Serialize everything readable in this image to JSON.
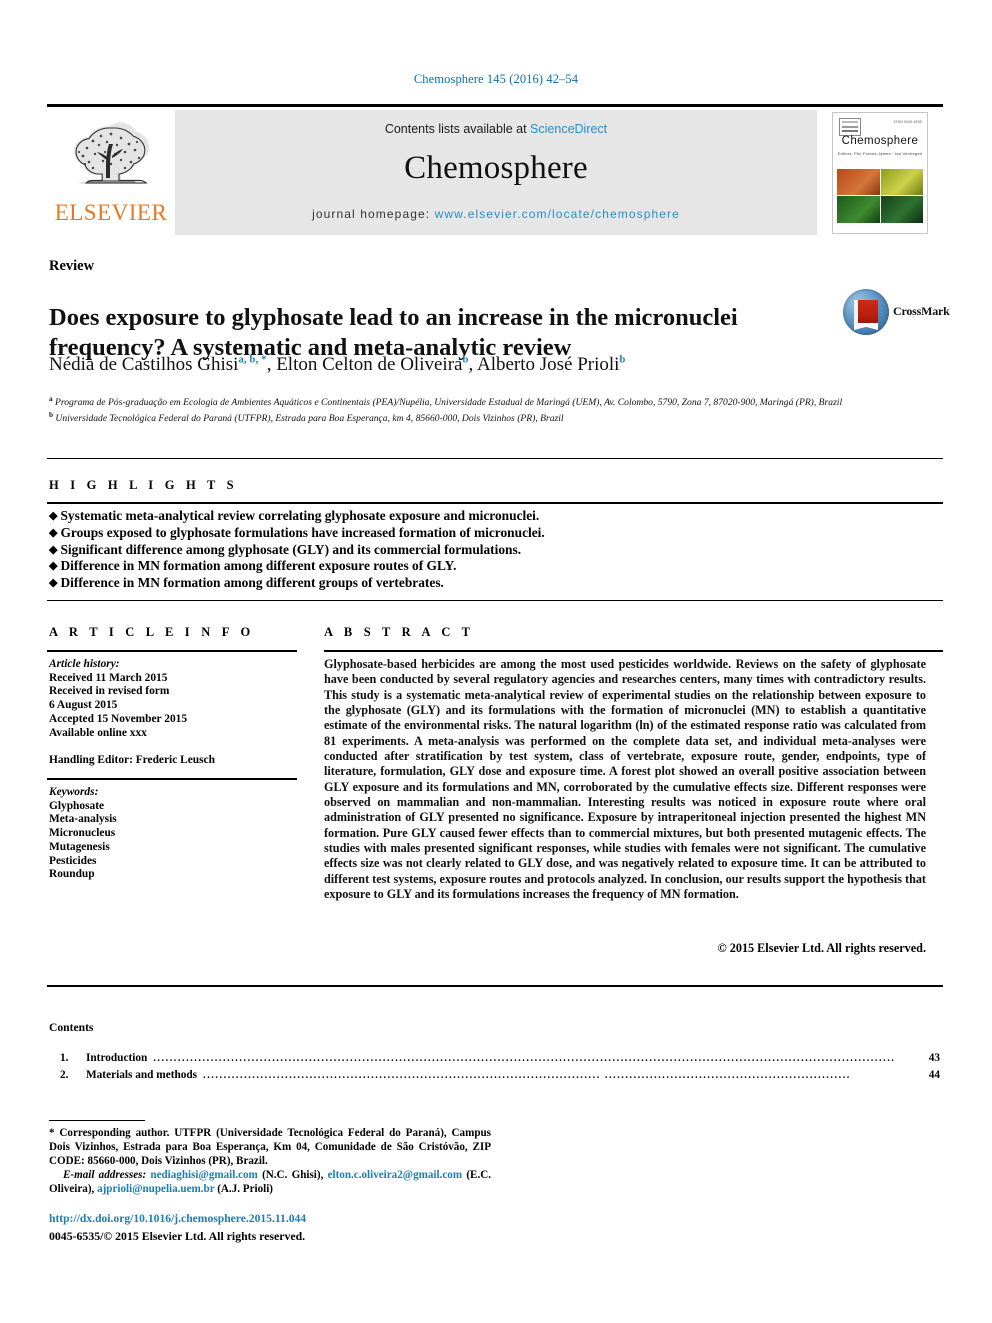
{
  "running_head": "Chemosphere 145 (2016) 42–54",
  "masthead": {
    "publisher_logo_text": "ELSEVIER",
    "contents_prefix": "Contents lists available at ",
    "contents_link": "ScienceDirect",
    "journal_title": "Chemosphere",
    "homepage_prefix": "journal homepage: ",
    "homepage_url": "www.elsevier.com/locate/chemosphere",
    "cover": {
      "journal_name": "Chemosphere",
      "subtitle": "Editors: Phil Forbes-James · Ian Verstegen",
      "issn_corner": "ISSN 0045-6535"
    }
  },
  "article": {
    "kind": "Review",
    "title": "Does exposure to glyphosate lead to an increase in the micronuclei frequency? A systematic and meta-analytic review",
    "crossmark_label": "CrossMark",
    "authors": [
      {
        "name": "Nédia de Castilhos Ghisi",
        "marks": "a, b, *"
      },
      {
        "name": "Elton Celton de Oliveira",
        "marks": "b"
      },
      {
        "name": "Alberto José Prioli",
        "marks": "b"
      }
    ],
    "affiliations": [
      {
        "mark": "a",
        "text": "Programa de Pós-graduação em Ecologia de Ambientes Aquáticos e Continentais (PEA)/Nupélia, Universidade Estadual de Maringá (UEM), Av. Colombo, 5790, Zona 7, 87020-900, Maringá (PR), Brazil"
      },
      {
        "mark": "b",
        "text": "Universidade Tecnológica Federal do Paraná (UTFPR), Estrada para Boa Esperança, km 4, 85660-000, Dois Vizinhos (PR), Brazil"
      }
    ]
  },
  "highlights": {
    "label": "H I G H L I G H T S",
    "items": [
      "Systematic meta-analytical review correlating glyphosate exposure and micronuclei.",
      "Groups exposed to glyphosate formulations have increased formation of micronuclei.",
      "Significant difference among glyphosate (GLY) and its commercial formulations.",
      "Difference in MN formation among different exposure routes of GLY.",
      "Difference in MN formation among different groups of vertebrates."
    ]
  },
  "article_info": {
    "label": "A R T I C L E  I N F O",
    "history_label": "Article history:",
    "history": [
      "Received 11 March 2015",
      "Received in revised form",
      "6 August 2015",
      "Accepted 15 November 2015",
      "Available online xxx"
    ],
    "handling_editor": "Handling Editor: Frederic Leusch",
    "keywords_label": "Keywords:",
    "keywords": [
      "Glyphosate",
      "Meta-analysis",
      "Micronucleus",
      "Mutagenesis",
      "Pesticides",
      "Roundup"
    ]
  },
  "abstract": {
    "label": "A B S T R A C T",
    "text": "Glyphosate-based herbicides are among the most used pesticides worldwide. Reviews on the safety of glyphosate have been conducted by several regulatory agencies and researches centers, many times with contradictory results. This study is a systematic meta-analytical review of experimental studies on the relationship between exposure to the glyphosate (GLY) and its formulations with the formation of micronuclei (MN) to establish a quantitative estimate of the environmental risks. The natural logarithm (ln) of the estimated response ratio was calculated from 81 experiments. A meta-analysis was performed on the complete data set, and individual meta-analyses were conducted after stratification by test system, class of vertebrate, exposure route, gender, endpoints, type of literature, formulation, GLY dose and exposure time. A forest plot showed an overall positive association between GLY exposure and its formulations and MN, corroborated by the cumulative effects size. Different responses were observed on mammalian and non-mammalian. Interesting results was noticed in exposure route where oral administration of GLY presented no significance. Exposure by intraperitoneal injection presented the highest MN formation. Pure GLY caused fewer effects than to commercial mixtures, but both presented mutagenic effects. The studies with males presented significant responses, while studies with females were not significant. The cumulative effects size was not clearly related to GLY dose, and was negatively related to exposure time. It can be attributed to different test systems, exposure routes and protocols analyzed. In conclusion, our results support the hypothesis that exposure to GLY and its formulations increases the frequency of MN formation.",
    "copyright": "© 2015 Elsevier Ltd. All rights reserved."
  },
  "contents": {
    "heading": "Contents",
    "entries": [
      {
        "num": "1.",
        "title": "Introduction",
        "page": "43"
      },
      {
        "num": "2.",
        "title": "Materials and methods",
        "page": "44"
      }
    ]
  },
  "footnote": {
    "corresponding": "* Corresponding author. UTFPR (Universidade Tecnológica Federal do Paraná), Campus Dois Vizinhos, Estrada para Boa Esperança, Km 04, Comunidade de São Cristóvão, ZIP CODE: 85660-000, Dois Vizinhos (PR), Brazil.",
    "email_label": "E-mail addresses:",
    "emails": [
      {
        "address": "nediaghisi@gmail.com",
        "owner": "(N.C. Ghisi)"
      },
      {
        "address": "elton.c.oliveira2@gmail.com",
        "owner": "(E.C. Oliveira)"
      },
      {
        "address": "ajprioli@nupelia.uem.br",
        "owner": "(A.J. Prioli)"
      }
    ]
  },
  "footer": {
    "doi": "http://dx.doi.org/10.1016/j.chemosphere.2015.11.044",
    "issn_line": "0045-6535/© 2015 Elsevier Ltd. All rights reserved."
  }
}
